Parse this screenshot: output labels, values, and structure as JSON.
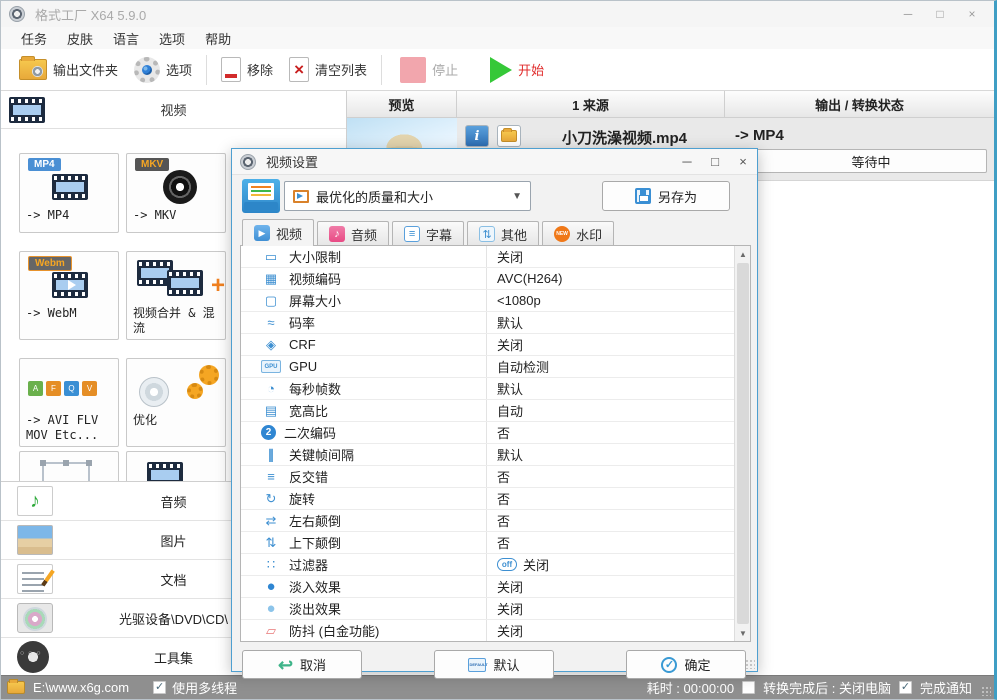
{
  "window": {
    "title": "格式工厂 X64 5.9.0",
    "controls": {
      "minimize": "─",
      "maximize": "□",
      "close": "×"
    }
  },
  "menu": {
    "items": [
      {
        "name": "task",
        "label": "任务"
      },
      {
        "name": "skin",
        "label": "皮肤"
      },
      {
        "name": "language",
        "label": "语言"
      },
      {
        "name": "options",
        "label": "选项"
      },
      {
        "name": "help",
        "label": "帮助"
      }
    ]
  },
  "toolbar": {
    "output_folder": "输出文件夹",
    "options": "选项",
    "remove": "移除",
    "clear_list": "清空列表",
    "stop": "停止",
    "start": "开始"
  },
  "left_panel": {
    "section_title": "视频",
    "tiles": [
      {
        "kind": "mp4",
        "badge": "MP4",
        "label": "-> MP4"
      },
      {
        "kind": "mkv",
        "badge": "MKV",
        "label": "-> MKV"
      },
      {
        "kind": "webm",
        "badge": "Webm",
        "label": "-> WebM"
      },
      {
        "kind": "merge",
        "badge": "",
        "label": "视频合并 & 混流"
      },
      {
        "kind": "avi-etc",
        "badge": "",
        "label": "-> AVI FLV MOV Etc..."
      },
      {
        "kind": "optimize",
        "badge": "",
        "label": "优化"
      }
    ],
    "categories": [
      {
        "kind": "audio",
        "label": "音频"
      },
      {
        "kind": "image",
        "label": "图片"
      },
      {
        "kind": "document",
        "label": "文档"
      },
      {
        "kind": "disc",
        "label": "光驱设备\\DVD\\CD\\"
      },
      {
        "kind": "tools",
        "label": "工具集"
      }
    ]
  },
  "queue": {
    "headers": [
      "预览",
      "1 来源",
      "输出 / 转换状态"
    ],
    "row": {
      "source_name": "小刀洗澡视频.mp4",
      "arrow": "->",
      "target": "MP4",
      "status": "等待中"
    }
  },
  "dialog": {
    "title": "视频设置",
    "preset": "最优化的质量和大小",
    "save_as": "另存为",
    "tabs": [
      {
        "kind": "video",
        "label": "视频",
        "active": true
      },
      {
        "kind": "audio",
        "label": "音频",
        "active": false
      },
      {
        "kind": "subtitle",
        "label": "字幕",
        "active": false
      },
      {
        "kind": "other",
        "label": "其他",
        "active": false
      },
      {
        "kind": "watermark",
        "label": "水印",
        "active": false
      }
    ],
    "settings": [
      {
        "icon": "size-limit",
        "label": "大小限制",
        "value": "关闭"
      },
      {
        "icon": "video-encoder",
        "label": "视频编码",
        "value": "AVC(H264)"
      },
      {
        "icon": "screen-size",
        "label": "屏幕大小",
        "value": "<1080p"
      },
      {
        "icon": "bitrate",
        "label": "码率",
        "value": "默认"
      },
      {
        "icon": "crf",
        "label": "CRF",
        "value": "关闭"
      },
      {
        "icon": "gpu",
        "label": "GPU",
        "value": "自动检测"
      },
      {
        "icon": "fps",
        "label": "每秒帧数",
        "value": "默认"
      },
      {
        "icon": "aspect-ratio",
        "label": "宽高比",
        "value": "自动"
      },
      {
        "icon": "two-pass",
        "label": "二次编码",
        "value": "否"
      },
      {
        "icon": "keyframe-interval",
        "label": "关键帧间隔",
        "value": "默认"
      },
      {
        "icon": "deinterlace",
        "label": "反交错",
        "value": "否"
      },
      {
        "icon": "rotate",
        "label": "旋转",
        "value": "否"
      },
      {
        "icon": "flip-horizontal",
        "label": "左右颠倒",
        "value": "否"
      },
      {
        "icon": "flip-vertical",
        "label": "上下颠倒",
        "value": "否"
      },
      {
        "icon": "filter",
        "label": "过滤器",
        "value": "关闭",
        "value_badge": "off"
      },
      {
        "icon": "fade-in",
        "label": "淡入效果",
        "value": "关闭"
      },
      {
        "icon": "fade-out",
        "label": "淡出效果",
        "value": "关闭"
      },
      {
        "icon": "stabilizer",
        "label": "防抖 (白金功能)",
        "value": "关闭"
      }
    ],
    "buttons": {
      "cancel": "取消",
      "default": "默认",
      "ok": "确定"
    }
  },
  "statusbar": {
    "output_path": "E:\\www.x6g.com",
    "multithread_label": "使用多线程",
    "multithread_checked": true,
    "elapsed_label": "耗时 : 00:00:00",
    "shutdown_label": "转换完成后 : 关闭电脑",
    "shutdown_checked": false,
    "notify_label": "完成通知",
    "notify_checked": true
  },
  "colors": {
    "accent_blue": "#3d8fd1",
    "start_green": "#35c838",
    "start_text_red": "#e02b2b",
    "stop_pink": "#f2a6ad",
    "badge_orange": "#f07818",
    "dialog_border": "#4e9fd0"
  }
}
